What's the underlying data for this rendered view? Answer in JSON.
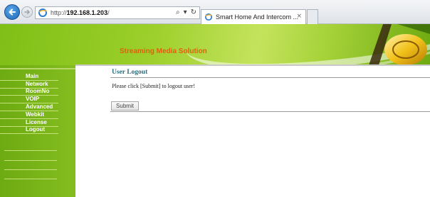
{
  "browser": {
    "address_prefix": "http://",
    "address_host": "192.168.1.203",
    "address_suffix": "/",
    "tab_title": "Smart Home And Intercom ...",
    "tab_close": "×",
    "search_glyph": "⌕",
    "dropdown_glyph": "▾",
    "refresh_glyph": "↻"
  },
  "banner": {
    "title": "Streaming Media Solution"
  },
  "sidebar": {
    "items": [
      {
        "label": "Main"
      },
      {
        "label": "Network"
      },
      {
        "label": "RoomNo"
      },
      {
        "label": "VOIP"
      },
      {
        "label": "Advanced"
      },
      {
        "label": "Webkit"
      },
      {
        "label": "License"
      },
      {
        "label": "Logout"
      }
    ]
  },
  "main": {
    "title": "User Logout",
    "message": "Please click [Submit] to logout user!",
    "submit_label": "Submit"
  },
  "colors": {
    "sidebar_green": "#7bb51a",
    "banner_text": "#e35f10",
    "title_teal": "#2e6c7a"
  }
}
